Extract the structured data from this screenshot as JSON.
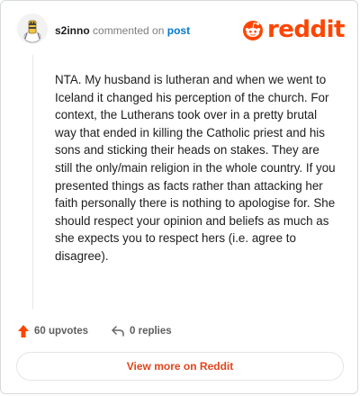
{
  "comment": {
    "username": "s2inno",
    "action_text": "commented on",
    "post_link_label": "post",
    "body": "NTA. My husband is lutheran and when we went to Iceland it changed his perception of the church. For context, the Lutherans took over in a pretty brutal way that ended in killing the Catholic priest and his sons and sticking their heads on stakes. They are still the only/main religion in the whole country. If you presented things as facts rather than attacking her faith personally there is nothing to apologise for. She should respect your opinion and beliefs as much as she expects you to respect hers (i.e. agree to disagree).",
    "upvotes_label": "60 upvotes",
    "replies_label": "0 replies"
  },
  "brand": {
    "logo_text": "reddit",
    "accent_color": "#ff4500",
    "icon": "reddit-alien-icon"
  },
  "footer": {
    "view_more_label": "View more on Reddit"
  },
  "icons": {
    "avatar": "avatar-icon",
    "upvote": "upvote-arrow-icon",
    "reply": "reply-arrow-icon"
  }
}
